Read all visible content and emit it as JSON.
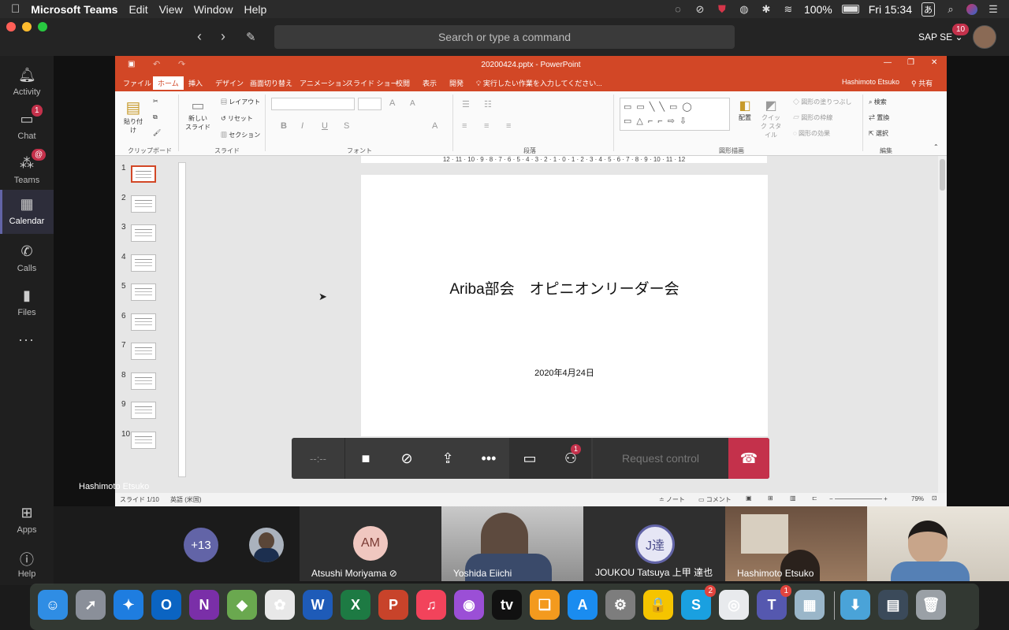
{
  "menubar": {
    "app_name": "Microsoft Teams",
    "items": [
      "Edit",
      "View",
      "Window",
      "Help"
    ],
    "battery": "100%",
    "clock": "Fri 15:34",
    "ime": "あ"
  },
  "titlebar": {
    "search_placeholder": "Search or type a command",
    "org_name": "SAP SE",
    "org_badge": "10"
  },
  "rail": {
    "items": [
      {
        "label": "Activity",
        "icon": "bell-icon",
        "badge": ""
      },
      {
        "label": "Chat",
        "icon": "chat-icon",
        "badge": "1"
      },
      {
        "label": "Teams",
        "icon": "teams-icon",
        "badge": "@"
      },
      {
        "label": "Calendar",
        "icon": "calendar-icon",
        "badge": ""
      },
      {
        "label": "Calls",
        "icon": "phone-icon",
        "badge": ""
      },
      {
        "label": "Files",
        "icon": "file-icon",
        "badge": ""
      },
      {
        "label": "...",
        "icon": "more-icon",
        "badge": ""
      }
    ],
    "apps_label": "Apps",
    "help_label": "Help"
  },
  "powerpoint": {
    "window_title": "20200424.pptx - PowerPoint",
    "tabs": [
      "ファイル",
      "ホーム",
      "挿入",
      "デザイン",
      "画面切り替え",
      "アニメーション",
      "スライド ショー",
      "校閲",
      "表示",
      "開発"
    ],
    "tell_me": "実行したい作業を入力してください...",
    "user": "Hashimoto Etsuko",
    "share": "共有",
    "ribbon_groups": [
      "クリップボード",
      "スライド",
      "フォント",
      "段落",
      "図形描画",
      "編集"
    ],
    "ribbon_buttons": {
      "paste": "貼り付け",
      "new_slide": "新しい スライド",
      "layout": "レイアウト",
      "reset": "リセット",
      "section": "セクション",
      "arrange": "配置",
      "quick_styles": "クイック スタイル",
      "shape_fill": "図形の塗りつぶし",
      "shape_outline": "図形の枠線",
      "shape_effects": "図形の効果",
      "find": "検索",
      "replace": "置換",
      "select": "選択"
    },
    "ruler_text": "12 · 11 · 10 · 9 · 8 · 7 · 6 · 5 · 4 · 3 · 2 · 1 · 0 · 1 · 2 · 3 · 4 · 5 · 6 · 7 · 8 · 9 · 10 · 11 · 12",
    "slide_count": 10,
    "selected_slide": 1,
    "slide": {
      "title": "Ariba部会　オピニオンリーダー会",
      "date": "2020年4月24日"
    },
    "status": {
      "slide_pos": "スライド 1/10",
      "language": "英語 (米国)",
      "notes": "ノート",
      "comments": "コメント",
      "zoom": "79%"
    }
  },
  "sharer_name": "Hashimoto Etsuko",
  "callbar": {
    "timer": "--:--",
    "chat_badge": "1",
    "request_control": "Request control"
  },
  "participants": {
    "overflow_count": "+13",
    "tiles": [
      {
        "name": "Atsushi Moriyama",
        "initials": "AM",
        "muted": true
      },
      {
        "name": "Yoshida Eiichi",
        "initials": ""
      },
      {
        "name": "JOUKOU Tatsuya 上甲 達也",
        "initials": "J達"
      },
      {
        "name": "Hashimoto Etsuko",
        "initials": ""
      },
      {
        "name": "",
        "initials": ""
      }
    ]
  },
  "dock": {
    "apps": [
      {
        "name": "Finder",
        "glyph": "☺",
        "color": "#2f8de4",
        "badge": ""
      },
      {
        "name": "Launchpad",
        "glyph": "➚",
        "color": "#8a8f99",
        "badge": ""
      },
      {
        "name": "Safari",
        "glyph": "✦",
        "color": "#1e7de0",
        "badge": ""
      },
      {
        "name": "Outlook",
        "glyph": "O",
        "color": "#0b64c2",
        "badge": ""
      },
      {
        "name": "OneNote",
        "glyph": "N",
        "color": "#7a2fa8",
        "badge": ""
      },
      {
        "name": "Maps",
        "glyph": "◆",
        "color": "#6aa84f",
        "badge": ""
      },
      {
        "name": "Photos",
        "glyph": "✿",
        "color": "#e8e8e8",
        "badge": ""
      },
      {
        "name": "Word",
        "glyph": "W",
        "color": "#1e5bb8",
        "badge": ""
      },
      {
        "name": "Excel",
        "glyph": "X",
        "color": "#1d7a43",
        "badge": ""
      },
      {
        "name": "PowerPoint",
        "glyph": "P",
        "color": "#c8432a",
        "badge": ""
      },
      {
        "name": "Music",
        "glyph": "♫",
        "color": "#f2435b",
        "badge": ""
      },
      {
        "name": "Podcasts",
        "glyph": "◉",
        "color": "#9b4fd6",
        "badge": ""
      },
      {
        "name": "TV",
        "glyph": "tv",
        "color": "#111111",
        "badge": ""
      },
      {
        "name": "Books",
        "glyph": "❑",
        "color": "#f39a1e",
        "badge": ""
      },
      {
        "name": "App Store",
        "glyph": "A",
        "color": "#1a8cf0",
        "badge": ""
      },
      {
        "name": "System Preferences",
        "glyph": "⚙",
        "color": "#7d7d7d",
        "badge": ""
      },
      {
        "name": "Keychain",
        "glyph": "🔒",
        "color": "#f5c400",
        "badge": ""
      },
      {
        "name": "Skype",
        "glyph": "S",
        "color": "#1aa0e0",
        "badge": "2"
      },
      {
        "name": "Chrome",
        "glyph": "◎",
        "color": "#e8eaed",
        "badge": ""
      },
      {
        "name": "Teams",
        "glyph": "T",
        "color": "#5558af",
        "badge": "1"
      },
      {
        "name": "Preview",
        "glyph": "▦",
        "color": "#9ab6c9",
        "badge": ""
      },
      {
        "name": "Downloads",
        "glyph": "⬇",
        "color": "#4aa3d8",
        "badge": ""
      },
      {
        "name": "Desktop",
        "glyph": "▤",
        "color": "#3b4a5a",
        "badge": ""
      },
      {
        "name": "Trash",
        "glyph": "🗑",
        "color": "#9aa0a6",
        "badge": ""
      }
    ]
  }
}
